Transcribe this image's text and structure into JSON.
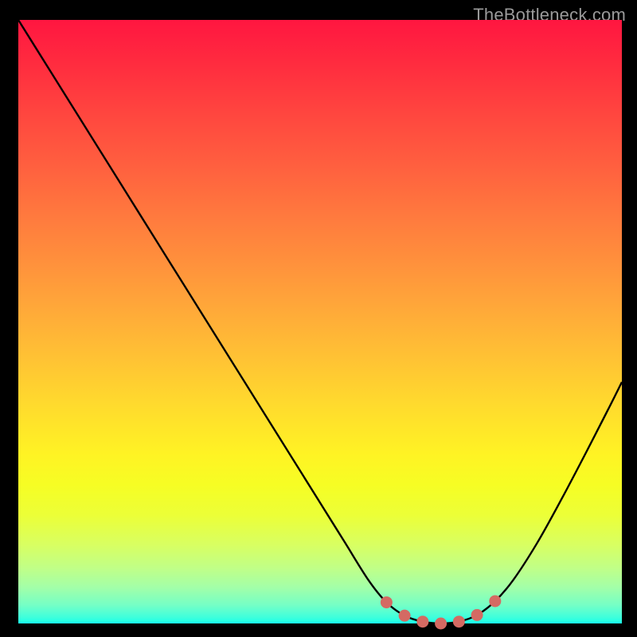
{
  "watermark": "TheBottleneck.com",
  "gradient_stops": [
    {
      "offset": 0.0,
      "color": "#ff1640"
    },
    {
      "offset": 0.08,
      "color": "#ff2e3f"
    },
    {
      "offset": 0.16,
      "color": "#ff473f"
    },
    {
      "offset": 0.24,
      "color": "#ff5f3f"
    },
    {
      "offset": 0.32,
      "color": "#ff783e"
    },
    {
      "offset": 0.4,
      "color": "#ff903c"
    },
    {
      "offset": 0.48,
      "color": "#ffa939"
    },
    {
      "offset": 0.56,
      "color": "#ffc234"
    },
    {
      "offset": 0.64,
      "color": "#ffdb2d"
    },
    {
      "offset": 0.72,
      "color": "#fff324"
    },
    {
      "offset": 0.77,
      "color": "#f6fd24"
    },
    {
      "offset": 0.82,
      "color": "#ecff37"
    },
    {
      "offset": 0.87,
      "color": "#d8ff62"
    },
    {
      "offset": 0.91,
      "color": "#bfff89"
    },
    {
      "offset": 0.94,
      "color": "#a3ffa8"
    },
    {
      "offset": 0.97,
      "color": "#74ffc6"
    },
    {
      "offset": 0.99,
      "color": "#3effdc"
    },
    {
      "offset": 1.0,
      "color": "#18ffe9"
    }
  ],
  "chart_data": {
    "type": "line",
    "title": "",
    "xlabel": "",
    "ylabel": "",
    "xlim": [
      0,
      100
    ],
    "ylim": [
      0,
      100
    ],
    "series": [
      {
        "name": "bottleneck-curve",
        "x": [
          0.0,
          5.0,
          10.0,
          15.0,
          20.0,
          25.0,
          30.0,
          35.0,
          40.0,
          45.0,
          50.0,
          54.0,
          58.0,
          61.0,
          64.0,
          67.0,
          70.0,
          73.0,
          76.0,
          79.0,
          82.0,
          86.0,
          90.0,
          94.0,
          98.0,
          100.0
        ],
        "y": [
          100.0,
          92.0,
          84.0,
          76.0,
          68.0,
          60.0,
          52.0,
          44.0,
          36.0,
          28.0,
          20.0,
          13.6,
          7.2,
          3.5,
          1.3,
          0.3,
          0.0,
          0.3,
          1.4,
          3.7,
          7.2,
          13.4,
          20.6,
          28.2,
          36.0,
          40.0
        ]
      }
    ],
    "markers": {
      "name": "optimal-zone",
      "color": "#d46a63",
      "points": [
        {
          "x": 61.0,
          "y": 3.5
        },
        {
          "x": 64.0,
          "y": 1.3
        },
        {
          "x": 67.0,
          "y": 0.3
        },
        {
          "x": 70.0,
          "y": 0.0
        },
        {
          "x": 73.0,
          "y": 0.3
        },
        {
          "x": 76.0,
          "y": 1.4
        },
        {
          "x": 79.0,
          "y": 3.7
        }
      ]
    }
  }
}
